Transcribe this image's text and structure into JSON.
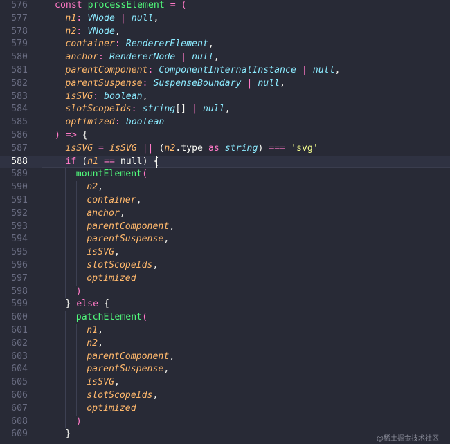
{
  "editor": {
    "active_line": 588,
    "lines": [
      {
        "n": "576",
        "indent": 0,
        "tokens": [
          [
            "kw",
            "const "
          ],
          [
            "fn",
            "processElement"
          ],
          [
            "pl",
            " "
          ],
          [
            "pu",
            "="
          ],
          [
            "pl",
            " "
          ],
          [
            "pu",
            "("
          ]
        ]
      },
      {
        "n": "577",
        "indent": 1,
        "tokens": [
          [
            "param",
            "n1"
          ],
          [
            "pu",
            ":"
          ],
          [
            "pl",
            " "
          ],
          [
            "type",
            "VNode"
          ],
          [
            "pl",
            " "
          ],
          [
            "pu",
            "|"
          ],
          [
            "pl",
            " "
          ],
          [
            "type",
            "null"
          ],
          [
            "pl",
            ","
          ]
        ]
      },
      {
        "n": "578",
        "indent": 1,
        "tokens": [
          [
            "param",
            "n2"
          ],
          [
            "pu",
            ":"
          ],
          [
            "pl",
            " "
          ],
          [
            "type",
            "VNode"
          ],
          [
            "pl",
            ","
          ]
        ]
      },
      {
        "n": "579",
        "indent": 1,
        "tokens": [
          [
            "param",
            "container"
          ],
          [
            "pu",
            ":"
          ],
          [
            "pl",
            " "
          ],
          [
            "type",
            "RendererElement"
          ],
          [
            "pl",
            ","
          ]
        ]
      },
      {
        "n": "580",
        "indent": 1,
        "tokens": [
          [
            "param",
            "anchor"
          ],
          [
            "pu",
            ":"
          ],
          [
            "pl",
            " "
          ],
          [
            "type",
            "RendererNode"
          ],
          [
            "pl",
            " "
          ],
          [
            "pu",
            "|"
          ],
          [
            "pl",
            " "
          ],
          [
            "type",
            "null"
          ],
          [
            "pl",
            ","
          ]
        ]
      },
      {
        "n": "581",
        "indent": 1,
        "tokens": [
          [
            "param",
            "parentComponent"
          ],
          [
            "pu",
            ":"
          ],
          [
            "pl",
            " "
          ],
          [
            "type",
            "ComponentInternalInstance"
          ],
          [
            "pl",
            " "
          ],
          [
            "pu",
            "|"
          ],
          [
            "pl",
            " "
          ],
          [
            "type",
            "null"
          ],
          [
            "pl",
            ","
          ]
        ]
      },
      {
        "n": "582",
        "indent": 1,
        "tokens": [
          [
            "param",
            "parentSuspense"
          ],
          [
            "pu",
            ":"
          ],
          [
            "pl",
            " "
          ],
          [
            "type",
            "SuspenseBoundary"
          ],
          [
            "pl",
            " "
          ],
          [
            "pu",
            "|"
          ],
          [
            "pl",
            " "
          ],
          [
            "type",
            "null"
          ],
          [
            "pl",
            ","
          ]
        ]
      },
      {
        "n": "583",
        "indent": 1,
        "tokens": [
          [
            "param",
            "isSVG"
          ],
          [
            "pu",
            ":"
          ],
          [
            "pl",
            " "
          ],
          [
            "type",
            "boolean"
          ],
          [
            "pl",
            ","
          ]
        ]
      },
      {
        "n": "584",
        "indent": 1,
        "tokens": [
          [
            "param",
            "slotScopeIds"
          ],
          [
            "pu",
            ":"
          ],
          [
            "pl",
            " "
          ],
          [
            "type",
            "string"
          ],
          [
            "pl",
            "[]"
          ],
          [
            "pl",
            " "
          ],
          [
            "pu",
            "|"
          ],
          [
            "pl",
            " "
          ],
          [
            "type",
            "null"
          ],
          [
            "pl",
            ","
          ]
        ]
      },
      {
        "n": "585",
        "indent": 1,
        "tokens": [
          [
            "param",
            "optimized"
          ],
          [
            "pu",
            ":"
          ],
          [
            "pl",
            " "
          ],
          [
            "type",
            "boolean"
          ]
        ]
      },
      {
        "n": "586",
        "indent": 0,
        "tokens": [
          [
            "pu",
            ")"
          ],
          [
            "pl",
            " "
          ],
          [
            "pu",
            "=>"
          ],
          [
            "pl",
            " "
          ],
          [
            "pl",
            "{"
          ]
        ]
      },
      {
        "n": "587",
        "indent": 1,
        "tokens": [
          [
            "param",
            "isSVG"
          ],
          [
            "pl",
            " "
          ],
          [
            "pu",
            "="
          ],
          [
            "pl",
            " "
          ],
          [
            "param",
            "isSVG"
          ],
          [
            "pl",
            " "
          ],
          [
            "pu",
            "||"
          ],
          [
            "pl",
            " ("
          ],
          [
            "param",
            "n2"
          ],
          [
            "pl",
            "."
          ],
          [
            "pl",
            "type"
          ],
          [
            "pl",
            " "
          ],
          [
            "kw",
            "as"
          ],
          [
            "pl",
            " "
          ],
          [
            "type",
            "string"
          ],
          [
            "pl",
            ") "
          ],
          [
            "pu",
            "==="
          ],
          [
            "pl",
            " "
          ],
          [
            "str",
            "'svg'"
          ]
        ]
      },
      {
        "n": "588",
        "indent": 1,
        "tokens": [
          [
            "kw",
            "if"
          ],
          [
            "pl",
            " ("
          ],
          [
            "param",
            "n1"
          ],
          [
            "pl",
            " "
          ],
          [
            "pu",
            "=="
          ],
          [
            "pl",
            " "
          ],
          [
            "pl",
            "null"
          ],
          [
            "pl",
            ") "
          ],
          [
            "pl",
            "{"
          ]
        ]
      },
      {
        "n": "589",
        "indent": 2,
        "tokens": [
          [
            "fn",
            "mountElement"
          ],
          [
            "pu",
            "("
          ]
        ]
      },
      {
        "n": "590",
        "indent": 3,
        "tokens": [
          [
            "param",
            "n2"
          ],
          [
            "pl",
            ","
          ]
        ]
      },
      {
        "n": "591",
        "indent": 3,
        "tokens": [
          [
            "param",
            "container"
          ],
          [
            "pl",
            ","
          ]
        ]
      },
      {
        "n": "592",
        "indent": 3,
        "tokens": [
          [
            "param",
            "anchor"
          ],
          [
            "pl",
            ","
          ]
        ]
      },
      {
        "n": "593",
        "indent": 3,
        "tokens": [
          [
            "param",
            "parentComponent"
          ],
          [
            "pl",
            ","
          ]
        ]
      },
      {
        "n": "594",
        "indent": 3,
        "tokens": [
          [
            "param",
            "parentSuspense"
          ],
          [
            "pl",
            ","
          ]
        ]
      },
      {
        "n": "595",
        "indent": 3,
        "tokens": [
          [
            "param",
            "isSVG"
          ],
          [
            "pl",
            ","
          ]
        ]
      },
      {
        "n": "596",
        "indent": 3,
        "tokens": [
          [
            "param",
            "slotScopeIds"
          ],
          [
            "pl",
            ","
          ]
        ]
      },
      {
        "n": "597",
        "indent": 3,
        "tokens": [
          [
            "param",
            "optimized"
          ]
        ]
      },
      {
        "n": "598",
        "indent": 2,
        "tokens": [
          [
            "pu",
            ")"
          ]
        ]
      },
      {
        "n": "599",
        "indent": 1,
        "tokens": [
          [
            "pl",
            "}"
          ],
          [
            "pl",
            " "
          ],
          [
            "kw",
            "else"
          ],
          [
            "pl",
            " {"
          ]
        ]
      },
      {
        "n": "600",
        "indent": 2,
        "tokens": [
          [
            "fn",
            "patchElement"
          ],
          [
            "pu",
            "("
          ]
        ]
      },
      {
        "n": "601",
        "indent": 3,
        "tokens": [
          [
            "param",
            "n1"
          ],
          [
            "pl",
            ","
          ]
        ]
      },
      {
        "n": "602",
        "indent": 3,
        "tokens": [
          [
            "param",
            "n2"
          ],
          [
            "pl",
            ","
          ]
        ]
      },
      {
        "n": "603",
        "indent": 3,
        "tokens": [
          [
            "param",
            "parentComponent"
          ],
          [
            "pl",
            ","
          ]
        ]
      },
      {
        "n": "604",
        "indent": 3,
        "tokens": [
          [
            "param",
            "parentSuspense"
          ],
          [
            "pl",
            ","
          ]
        ]
      },
      {
        "n": "605",
        "indent": 3,
        "tokens": [
          [
            "param",
            "isSVG"
          ],
          [
            "pl",
            ","
          ]
        ]
      },
      {
        "n": "606",
        "indent": 3,
        "tokens": [
          [
            "param",
            "slotScopeIds"
          ],
          [
            "pl",
            ","
          ]
        ]
      },
      {
        "n": "607",
        "indent": 3,
        "tokens": [
          [
            "param",
            "optimized"
          ]
        ]
      },
      {
        "n": "608",
        "indent": 2,
        "tokens": [
          [
            "pu",
            ")"
          ]
        ]
      },
      {
        "n": "609",
        "indent": 1,
        "tokens": [
          [
            "pl",
            "}"
          ]
        ]
      }
    ]
  },
  "watermark": "@稀土掘金技术社区",
  "colors": {
    "background": "#282a36",
    "keyword": "#ff79c6",
    "function": "#50fa7b",
    "parameter": "#ffb86c",
    "type": "#8be9fd",
    "string": "#f1fa8c",
    "plain": "#f8f8f2",
    "line_number": "#6a6d82"
  }
}
